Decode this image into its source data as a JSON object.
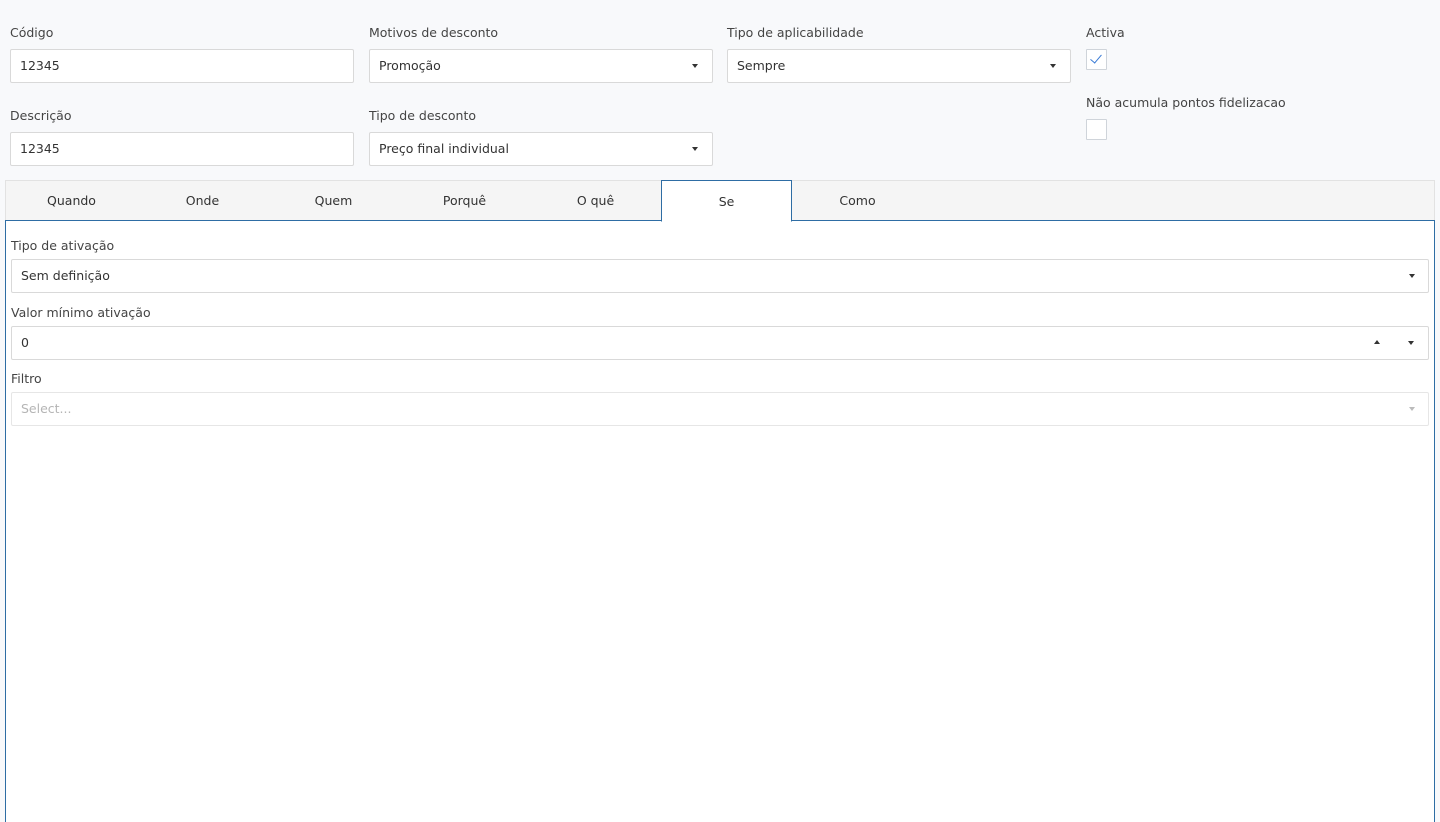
{
  "form": {
    "codigo": {
      "label": "Código",
      "value": "12345"
    },
    "motivos": {
      "label": "Motivos de desconto",
      "value": "Promoção"
    },
    "aplicabilidade": {
      "label": "Tipo de aplicabilidade",
      "value": "Sempre"
    },
    "activa": {
      "label": "Activa",
      "checked": true
    },
    "descricao": {
      "label": "Descrição",
      "value": "12345"
    },
    "tipo_desconto": {
      "label": "Tipo de desconto",
      "value": "Preço final individual"
    },
    "nao_acumula": {
      "label": "Não acumula pontos fidelizacao",
      "checked": false
    }
  },
  "tabs": [
    {
      "label": "Quando",
      "active": false
    },
    {
      "label": "Onde",
      "active": false
    },
    {
      "label": "Quem",
      "active": false
    },
    {
      "label": "Porquê",
      "active": false
    },
    {
      "label": "O quê",
      "active": false
    },
    {
      "label": "Se",
      "active": true
    },
    {
      "label": "Como",
      "active": false
    }
  ],
  "panel": {
    "tipo_ativacao": {
      "label": "Tipo de ativação",
      "value": "Sem definição"
    },
    "valor_minimo": {
      "label": "Valor mínimo ativação",
      "value": "0"
    },
    "filtro": {
      "label": "Filtro",
      "placeholder": "Select..."
    }
  },
  "colors": {
    "accent": "#2e6da4",
    "check": "#3a7bd5",
    "background": "#f8f9fb"
  }
}
